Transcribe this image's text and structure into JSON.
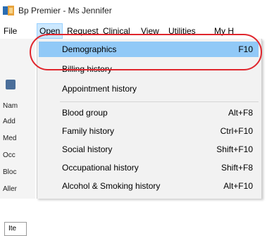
{
  "window": {
    "title": "Bp Premier - Ms Jennifer"
  },
  "menubar": {
    "items": [
      {
        "label": "File"
      },
      {
        "label": "Open"
      },
      {
        "label": "Request"
      },
      {
        "label": "Clinical"
      },
      {
        "label": "View"
      },
      {
        "label": "Utilities"
      },
      {
        "label": "My H"
      }
    ],
    "active": "Open"
  },
  "left_panel": {
    "labels": [
      "Nam",
      "Add",
      "Med",
      "Occ",
      "Bloc",
      "Aller"
    ],
    "input_value": "Ite"
  },
  "open_menu": {
    "items": [
      {
        "label": "Demographics",
        "shortcut": "F10"
      },
      {
        "label": "Billing history",
        "shortcut": ""
      },
      {
        "label": "Appointment history",
        "shortcut": ""
      },
      {
        "label": "Blood group",
        "shortcut": "Alt+F8"
      },
      {
        "label": "Family history",
        "shortcut": "Ctrl+F10"
      },
      {
        "label": "Social history",
        "shortcut": "Shift+F10"
      },
      {
        "label": "Occupational history",
        "shortcut": "Shift+F8"
      },
      {
        "label": "Alcohol & Smoking history",
        "shortcut": "Alt+F10"
      }
    ],
    "highlighted": "Demographics"
  },
  "colors": {
    "highlight": "#91c9f7",
    "callout": "#e0262d",
    "menu_bg": "#f2f2f2"
  }
}
